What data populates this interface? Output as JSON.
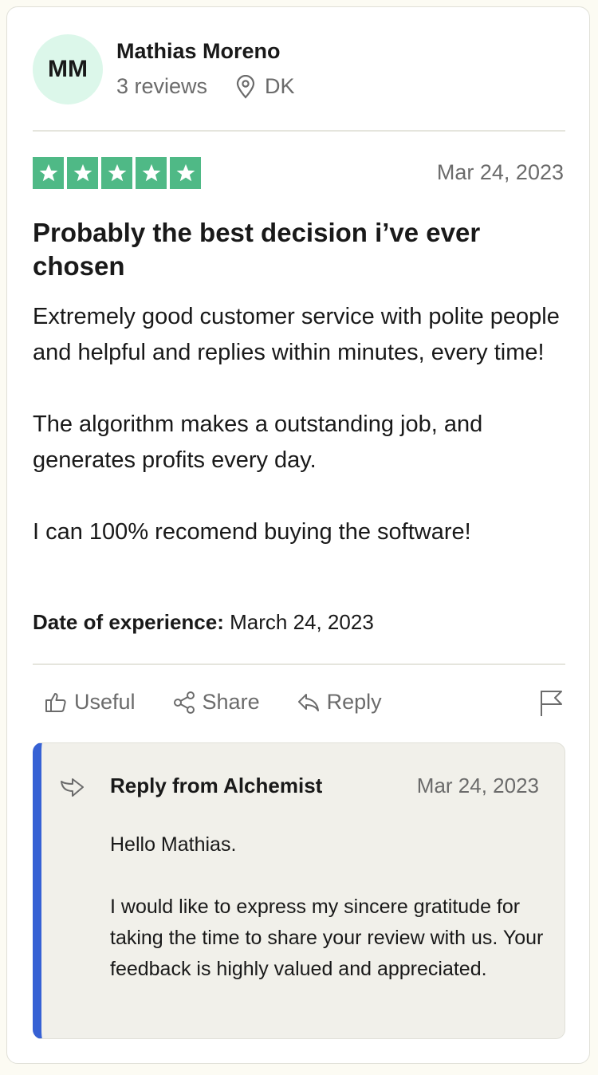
{
  "reviewer": {
    "initials": "MM",
    "name": "Mathias Moreno",
    "reviews_count": "3 reviews",
    "location": "DK",
    "avatar_color": "#dcf7ea"
  },
  "review": {
    "rating": 5,
    "rating_max": 5,
    "star_color": "#4fb986",
    "date": "Mar 24, 2023",
    "title": "Probably the best decision i’ve ever chosen",
    "paragraphs": [
      "Extremely good customer service with polite people and helpful and replies within minutes, every time!",
      "The algorithm makes a outstanding job, and generates profits every day.",
      "I can 100% recomend buying the software!"
    ],
    "experience_label": "Date of experience:",
    "experience_date": "March 24, 2023"
  },
  "actions": {
    "useful_label": "Useful",
    "share_label": "Share",
    "reply_label": "Reply",
    "icons": [
      "thumbs-up-icon",
      "share-icon",
      "reply-arrow-icon",
      "flag-icon"
    ]
  },
  "reply": {
    "title": "Reply from Alchemist",
    "date": "Mar 24, 2023",
    "accent_color": "#3661d4",
    "paragraphs": [
      "Hello Mathias.",
      "I would like to express my sincere gratitude for taking the time to share your review with us. Your feedback is highly valued and appreciated."
    ]
  }
}
